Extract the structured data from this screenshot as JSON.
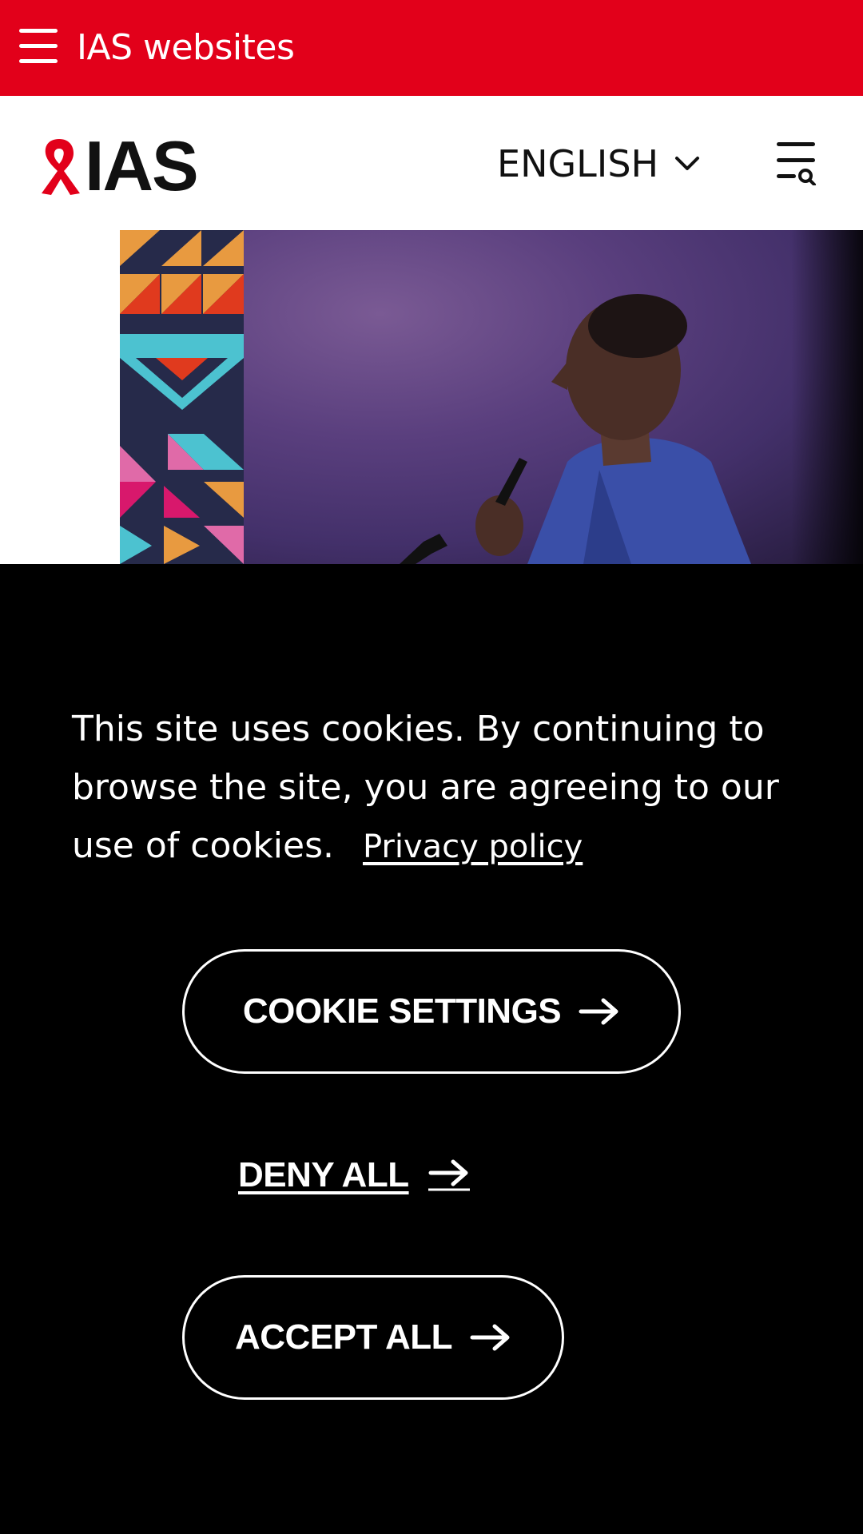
{
  "topbar": {
    "title": "IAS websites",
    "background_color": "#e2001a",
    "menu_icon": "hamburger-icon"
  },
  "header": {
    "logo_text": "IAS",
    "logo_icon": "red-ribbon-icon",
    "language_label": "ENGLISH",
    "language_icon": "chevron-down-icon",
    "menu_search_icon": "menu-search-icon"
  },
  "hero": {
    "image_description": "speaker-photo"
  },
  "cookie_banner": {
    "message": "This site uses cookies. By continuing to browse the site, you are agreeing to our use of cookies.",
    "privacy_link": "Privacy policy",
    "cookie_settings_label": "COOKIE SETTINGS",
    "deny_all_label": "DENY ALL",
    "accept_all_label": "ACCEPT ALL",
    "arrow_icon": "arrow-right-icon",
    "background_color": "#000000"
  }
}
